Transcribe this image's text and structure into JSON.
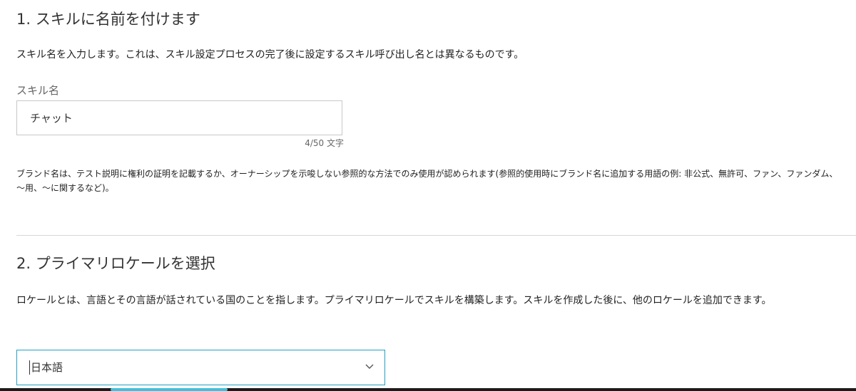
{
  "section1": {
    "heading": "1. スキルに名前を付けます",
    "description": "スキル名を入力します。これは、スキル設定プロセスの完了後に設定するスキル呼び出し名とは異なるものです。",
    "field_label": "スキル名",
    "input_value": "チャット",
    "counter": "4/50 文字",
    "brand_note": "ブランド名は、テスト説明に権利の証明を記載するか、オーナーシップを示唆しない参照的な方法でのみ使用が認められます(参照的使用時にブランド名に追加する用語の例: 非公式、無許可、ファン、ファンダム、～用、～に関するなど)。"
  },
  "section2": {
    "heading": "2. プライマリロケールを選択",
    "description": "ロケールとは、言語とその言語が話されている国のことを指します。プライマリロケールでスキルを構築します。スキルを作成した後に、他のロケールを追加できます。",
    "selected_locale": "日本語",
    "dropdown_icon": "chevron-down-icon"
  },
  "colors": {
    "focus_border": "#21a1c4",
    "bottom_accent": "#3fc0dc",
    "divider": "#d6d6d6"
  }
}
